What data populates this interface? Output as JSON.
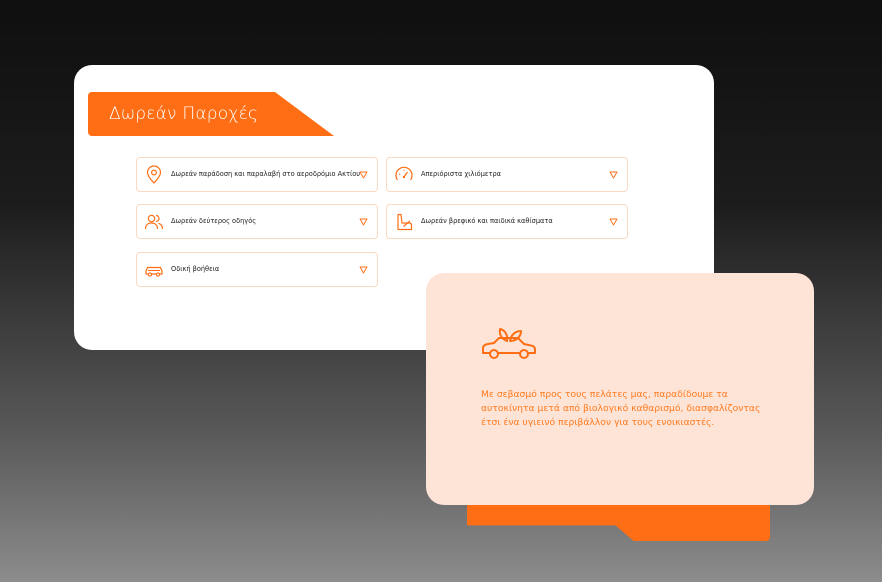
{
  "panel": {
    "title": "Δωρεάν Παροχές",
    "items": [
      {
        "label": "Δωρεάν παράδοση και παραλαβή στο αεροδρόμιο Ακτίου",
        "icon": "location-pin-icon"
      },
      {
        "label": "Απεριόριστα χιλιόμετρα",
        "icon": "speedometer-icon"
      },
      {
        "label": "Δωρεάν δεύτερος οδηγός",
        "icon": "users-icon"
      },
      {
        "label": "Δωρεάν βρεφικό και παιδικά καθίσματα",
        "icon": "car-seat-icon"
      },
      {
        "label": "Οδική βοήθεια",
        "icon": "roadside-assistance-icon"
      }
    ]
  },
  "promo": {
    "icon": "eco-car-icon",
    "text": "Με σεβασμό προς τους πελάτες μας, παραδίδουμε τα αυτοκίνητα μετά από βιολογικό καθαρισμό, διασφαλίζοντας έτσι ένα υγιεινό περιβάλλον για τους ενοικιαστές."
  },
  "colors": {
    "accent": "#ff6e14",
    "peach": "#fde4d6",
    "border": "#fbd9c2"
  }
}
